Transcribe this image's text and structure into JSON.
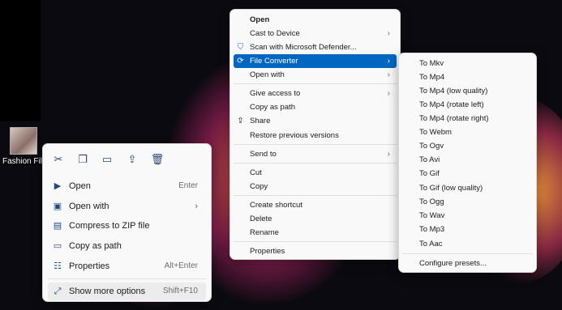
{
  "desktop": {
    "file_label": "Fashion File"
  },
  "classic_menu": {
    "items": [
      {
        "label": "Open",
        "bold": true
      },
      {
        "label": "Cast to Device",
        "submenu": true
      },
      {
        "label": "Scan with Microsoft Defender...",
        "icon": "defender-shield-icon"
      },
      {
        "label": "File Converter",
        "submenu": true,
        "selected": true,
        "icon": "file-converter-icon"
      },
      {
        "label": "Open with",
        "submenu": true
      },
      {
        "label": "Give access to",
        "submenu": true
      },
      {
        "label": "Copy as path"
      },
      {
        "label": "Share",
        "icon": "share-icon"
      },
      {
        "label": "Restore previous versions"
      },
      {
        "label": "Send to",
        "submenu": true
      },
      {
        "label": "Cut"
      },
      {
        "label": "Copy"
      },
      {
        "label": "Create shortcut"
      },
      {
        "label": "Delete"
      },
      {
        "label": "Rename"
      },
      {
        "label": "Properties"
      }
    ],
    "arrow": "›",
    "selected_color": "#0067c0"
  },
  "converter_submenu": {
    "items": [
      "To Mkv",
      "To Mp4",
      "To Mp4 (low quality)",
      "To Mp4 (rotate left)",
      "To Mp4 (rotate right)",
      "To Webm",
      "To Ogv",
      "To Avi",
      "To Gif",
      "To Gif (low quality)",
      "To Ogg",
      "To Wav",
      "To Mp3",
      "To Aac"
    ],
    "footer": "Configure presets..."
  },
  "modern_menu": {
    "toolbar_icons": [
      "cut-icon",
      "copy-icon",
      "rename-icon",
      "share-icon",
      "delete-icon"
    ],
    "items": [
      {
        "label": "Open",
        "shortcut": "Enter",
        "icon": "open-app-icon"
      },
      {
        "label": "Open with",
        "submenu": true,
        "icon": "open-with-icon"
      },
      {
        "label": "Compress to ZIP file",
        "icon": "zip-icon"
      },
      {
        "label": "Copy as path",
        "icon": "copy-path-icon"
      },
      {
        "label": "Properties",
        "shortcut": "Alt+Enter",
        "icon": "properties-icon"
      },
      {
        "label": "Show more options",
        "shortcut": "Shift+F10",
        "icon": "show-more-icon"
      }
    ]
  }
}
